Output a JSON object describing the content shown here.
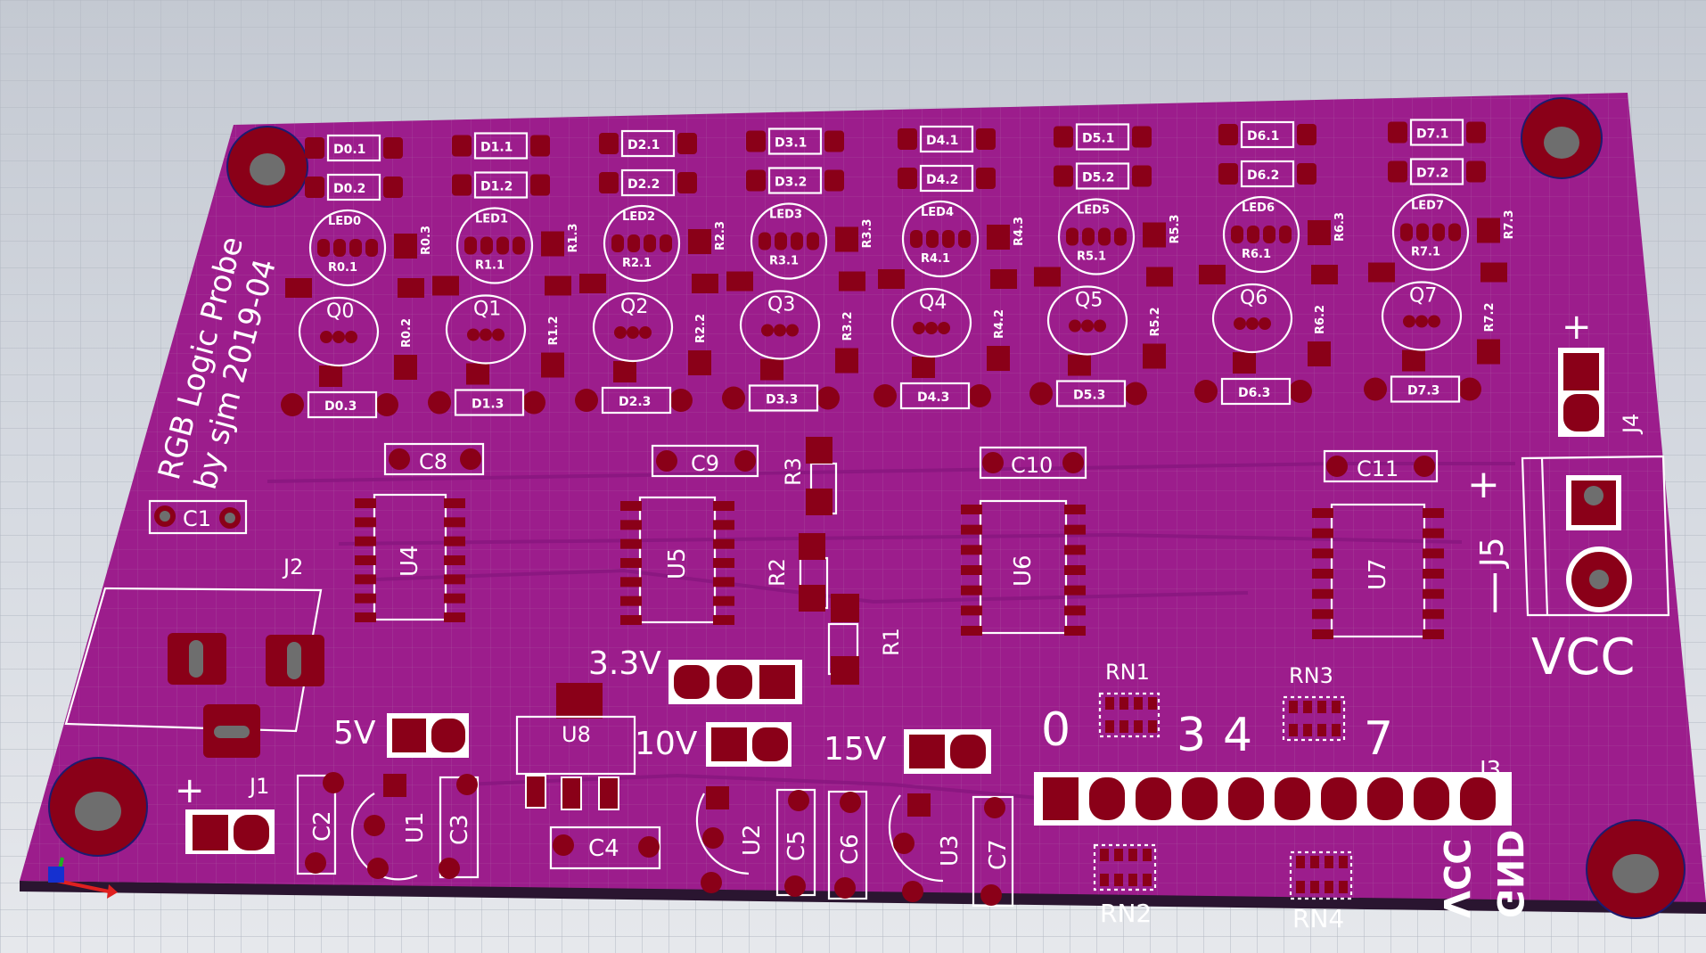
{
  "colors": {
    "board": "#9c1d8c",
    "copper_pad": "#8a0018",
    "silkscreen": "#ffffff",
    "background": "#d0d4da"
  },
  "board": {
    "title_line1": "RGB  Logic Probe",
    "title_line2": "by  sjm  2019-04"
  },
  "leds": [
    {
      "name": "LED0",
      "diode_a": "D0.1",
      "diode_b": "D0.2",
      "diode_c": "D0.3",
      "r1": "R0.1",
      "r2": "R0.2",
      "r3": "R0.3",
      "transistor": "Q0"
    },
    {
      "name": "LED1",
      "diode_a": "D1.1",
      "diode_b": "D1.2",
      "diode_c": "D1.3",
      "r1": "R1.1",
      "r2": "R1.2",
      "r3": "R1.3",
      "transistor": "Q1"
    },
    {
      "name": "LED2",
      "diode_a": "D2.1",
      "diode_b": "D2.2",
      "diode_c": "D2.3",
      "r1": "R2.1",
      "r2": "R2.2",
      "r3": "R2.3",
      "transistor": "Q2"
    },
    {
      "name": "LED3",
      "diode_a": "D3.1",
      "diode_b": "D3.2",
      "diode_c": "D3.3",
      "r1": "R3.1",
      "r2": "R3.2",
      "r3": "R3.3",
      "transistor": "Q3"
    },
    {
      "name": "LED4",
      "diode_a": "D4.1",
      "diode_b": "D4.2",
      "diode_c": "D4.3",
      "r1": "R4.1",
      "r2": "R4.2",
      "r3": "R4.3",
      "transistor": "Q4"
    },
    {
      "name": "LED5",
      "diode_a": "D5.1",
      "diode_b": "D5.2",
      "diode_c": "D5.3",
      "r1": "R5.1",
      "r2": "R5.2",
      "r3": "R5.3",
      "transistor": "Q5"
    },
    {
      "name": "LED6",
      "diode_a": "D6.1",
      "diode_b": "D6.2",
      "diode_c": "D6.3",
      "r1": "R6.1",
      "r2": "R6.2",
      "r3": "R6.3",
      "transistor": "Q6"
    },
    {
      "name": "LED7",
      "diode_a": "D7.1",
      "diode_b": "D7.2",
      "diode_c": "D7.3",
      "r1": "R7.1",
      "r2": "R7.2",
      "r3": "R7.3",
      "transistor": "Q7"
    }
  ],
  "capacitors": {
    "c1": "C1",
    "c2": "C2",
    "c3": "C3",
    "c4": "C4",
    "c5": "C5",
    "c6": "C6",
    "c7": "C7",
    "c8": "C8",
    "c9": "C9",
    "c10": "C10",
    "c11": "C11"
  },
  "ics": {
    "u1": "U1",
    "u2": "U2",
    "u3": "U3",
    "u4": "U4",
    "u5": "U5",
    "u6": "U6",
    "u7": "U7",
    "u8": "U8"
  },
  "resistors": {
    "r1": "R1",
    "r2": "R2",
    "r3": "R3"
  },
  "networks": {
    "rn1": "RN1",
    "rn2": "RN2",
    "rn3": "RN3",
    "rn4": "RN4"
  },
  "connectors": {
    "j1": "J1",
    "j1_plus": "+",
    "j2": "J2",
    "j3": "J3",
    "j4": "J4",
    "j4_plus": "+",
    "j5": "J5",
    "j5_plus": "+",
    "j5_minus": "|",
    "vcc": "VCC"
  },
  "voltage_jumpers": {
    "v33": "3.3V",
    "v5": "5V",
    "v10": "10V",
    "v15": "15V"
  },
  "j3_labels": {
    "zero": "0",
    "three": "3",
    "four": "4",
    "seven": "7",
    "vcc": "VCC",
    "gnd": "GND"
  }
}
